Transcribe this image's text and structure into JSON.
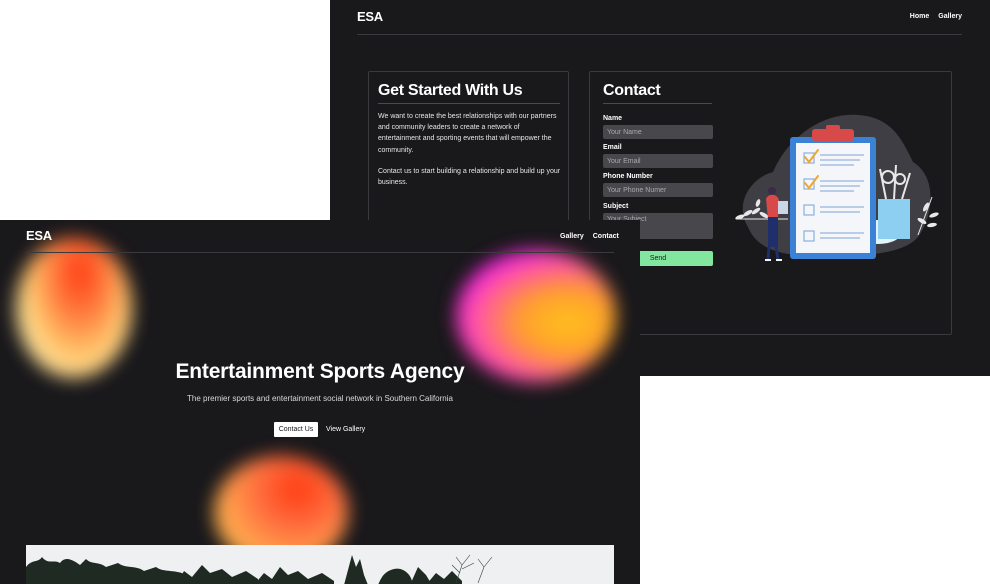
{
  "back_window": {
    "logo": "ESA",
    "nav": [
      "Home",
      "Gallery"
    ],
    "intro_card": {
      "title": "Get Started With Us",
      "paragraph1": "We want to create the best relationships with our partners and community leaders to create a network of entertainment and sporting events that will empower the community.",
      "paragraph2": "Contact us to start building a relationship and build up your business."
    },
    "contact_card": {
      "title": "Contact",
      "fields": [
        {
          "label": "Name",
          "placeholder": "Your Name"
        },
        {
          "label": "Email",
          "placeholder": "Your Email"
        },
        {
          "label": "Phone Number",
          "placeholder": "Your Phone Numer"
        },
        {
          "label": "Subject",
          "placeholder": "Your Subject"
        }
      ],
      "send_label": "Send"
    }
  },
  "front_window": {
    "logo": "ESA",
    "nav": [
      "Gallery",
      "Contact"
    ],
    "hero": {
      "title": "Entertainment Sports Agency",
      "subtitle": "The premier sports and entertainment social network in Southern California",
      "primary_button": "Contact Us",
      "secondary_button": "View Gallery"
    }
  },
  "colors": {
    "background": "#19181b",
    "send_button": "#83e6a0",
    "input_bg": "#48474b",
    "clipboard_blue": "#3b82d6",
    "check_orange": "#f0a72b"
  },
  "icons": [
    "clipboard-checklist-illustration"
  ]
}
